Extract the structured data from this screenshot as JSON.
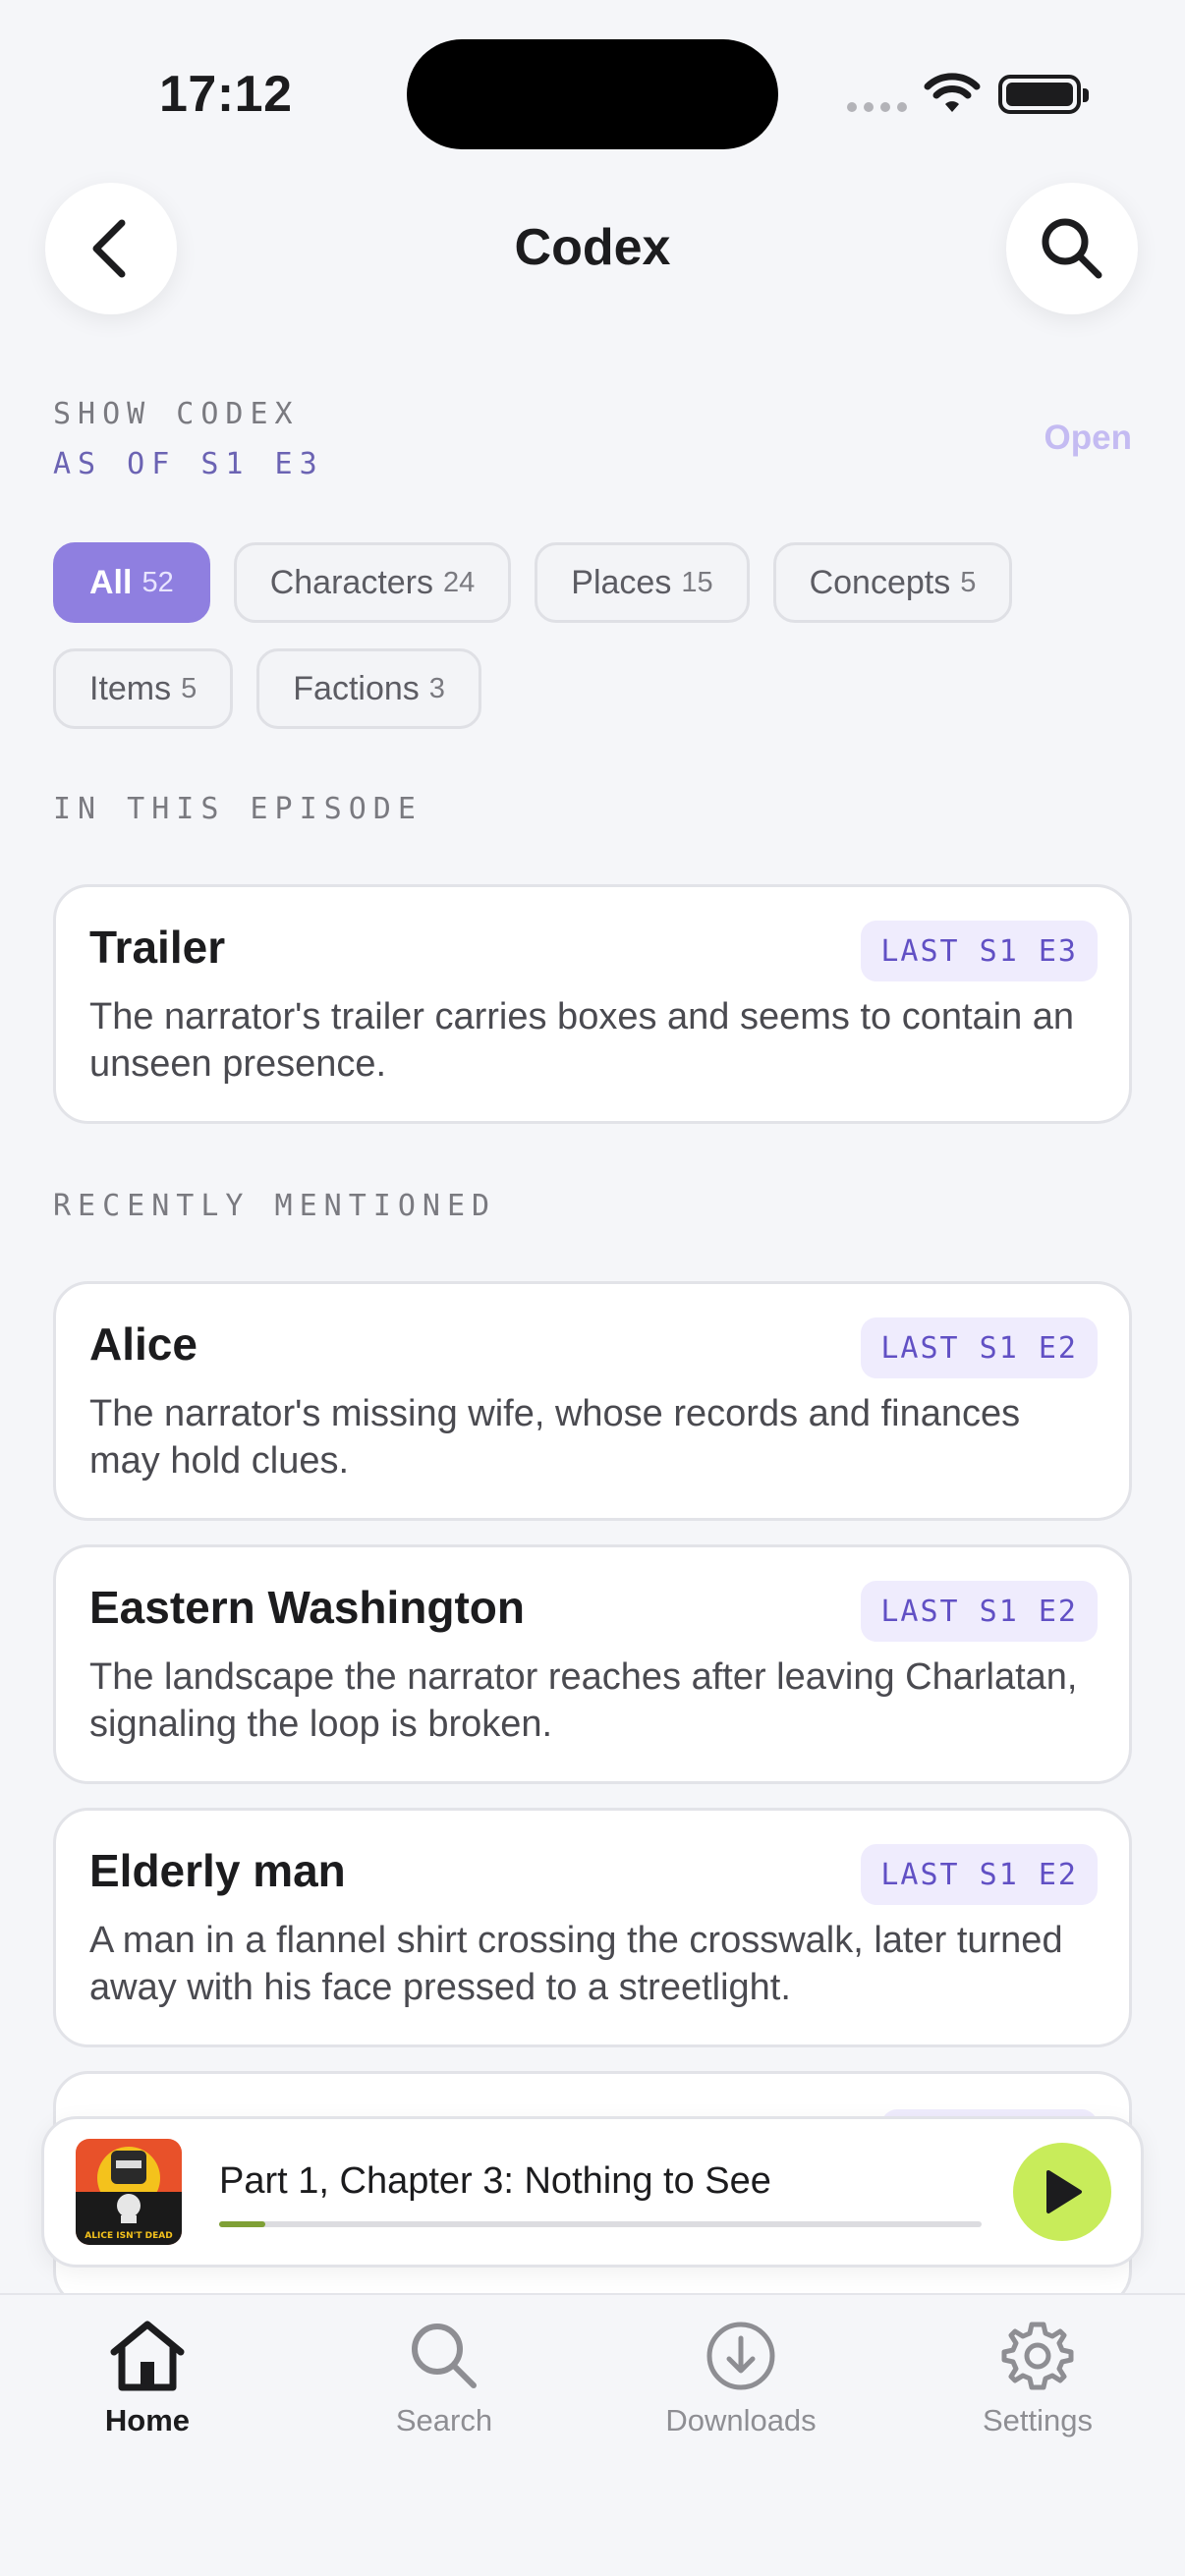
{
  "status_bar": {
    "time": "17:12"
  },
  "header": {
    "title": "Codex"
  },
  "codex": {
    "show_label": "SHOW CODEX",
    "as_of": "AS OF S1 E3",
    "open_label": "Open"
  },
  "filters": [
    {
      "label": "All",
      "count": "52",
      "active": true
    },
    {
      "label": "Characters",
      "count": "24",
      "active": false
    },
    {
      "label": "Places",
      "count": "15",
      "active": false
    },
    {
      "label": "Concepts",
      "count": "5",
      "active": false
    },
    {
      "label": "Items",
      "count": "5",
      "active": false
    },
    {
      "label": "Factions",
      "count": "3",
      "active": false
    }
  ],
  "sections": {
    "in_episode": "IN THIS EPISODE",
    "recent": "RECENTLY MENTIONED"
  },
  "in_episode": [
    {
      "title": "Trailer",
      "badge": "LAST S1 E3",
      "desc": "The narrator's trailer carries boxes and seems to contain an unseen presence."
    }
  ],
  "recent": [
    {
      "title": "Alice",
      "badge": "LAST S1 E2",
      "desc": "The narrator's missing wife, whose records and finances may hold clues."
    },
    {
      "title": "Eastern Washington",
      "badge": "LAST S1 E2",
      "desc": "The landscape the narrator reaches after leaving Charlatan, signaling the loop is broken."
    },
    {
      "title": "Elderly man",
      "badge": "LAST S1 E2",
      "desc": "A man in a flannel shirt crossing the crosswalk, later turned away with his face pressed to a streetlight."
    }
  ],
  "player": {
    "title": "Part 1, Chapter 3: Nothing to See",
    "cover_text": "ALICE ISN'T DEAD",
    "progress": 0.06
  },
  "tabs": [
    {
      "label": "Home",
      "icon": "home-icon",
      "active": true
    },
    {
      "label": "Search",
      "icon": "search-icon",
      "active": false
    },
    {
      "label": "Downloads",
      "icon": "download-icon",
      "active": false
    },
    {
      "label": "Settings",
      "icon": "gear-icon",
      "active": false
    }
  ],
  "colors": {
    "accent": "#8f7fe0",
    "badge_bg": "#efecfd",
    "badge_text": "#6150c4",
    "play_button": "#c8ec5a"
  }
}
